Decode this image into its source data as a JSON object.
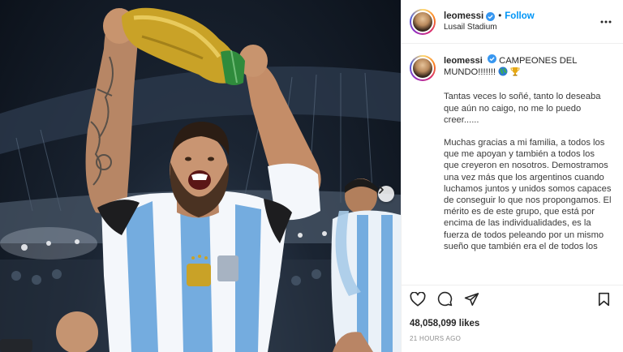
{
  "post": {
    "username": "leomessi",
    "follow_label": "Follow",
    "separator": "•",
    "location": "Lusail Stadium",
    "caption_title": "CAMPEONES DEL MUNDO!!!!!!!",
    "caption_emojis": [
      "globe-icon",
      "trophy-icon"
    ],
    "caption_paragraphs": [
      "Tantas veces lo soñé, tanto lo deseaba que aún no caigo, no me lo puedo creer......",
      "Muchas gracias a mi familia, a todos los que me apoyan y también a todos los que creyeron en nosotros. Demostramos una vez más que los argentinos cuando luchamos juntos y unidos somos capaces de conseguir lo que nos propongamos. El mérito es de este grupo, que está por encima de las individualidades, es la fuerza de todos peleando por un mismo sueño que también era el de todos los"
    ],
    "likes": "48,058,099 likes",
    "timestamp": "21 HOURS AGO"
  },
  "icons": {
    "verified": "verified-badge-icon",
    "more": "more-options-icon",
    "like": "heart-icon",
    "comment": "comment-icon",
    "share": "share-icon",
    "save": "bookmark-icon",
    "next": "chevron-right-icon"
  },
  "colors": {
    "link_blue": "#0095f6",
    "verified_blue": "#3897f0",
    "text": "#262626",
    "muted": "#8e8e8e",
    "jersey_blue": "#74acdf",
    "trophy_gold": "#c9a227"
  }
}
